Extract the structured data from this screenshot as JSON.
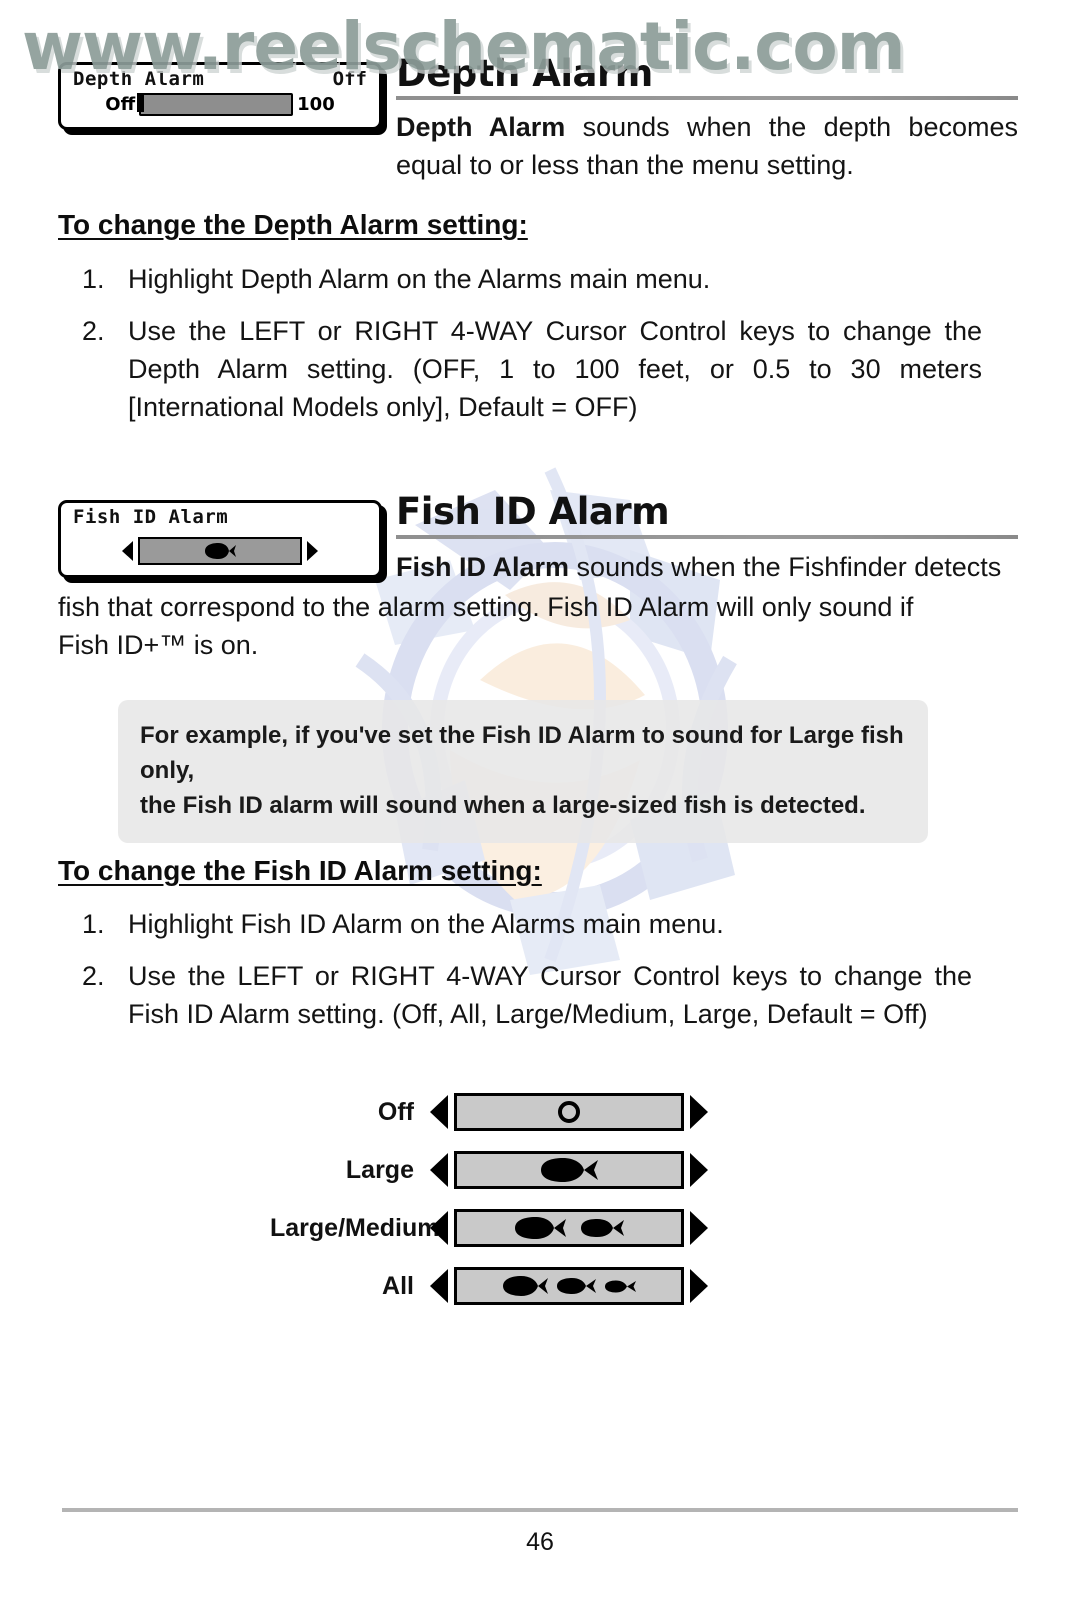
{
  "watermark": {
    "url_text": "www.reelschematic.com",
    "color": "#8d9d99",
    "logo_blue": "#b9c0e0",
    "logo_peach": "#f6dcc0"
  },
  "depth_widget": {
    "title": "Depth Alarm",
    "value": "Off",
    "slider_min_label": "Off",
    "slider_max_label": "100"
  },
  "depth_section": {
    "heading": "Depth Alarm",
    "paragraph_bold": "Depth Alarm",
    "paragraph_rest": " sounds when the depth becomes equal to or less than the menu setting.",
    "subhead": "To change the Depth Alarm setting:",
    "steps": [
      {
        "marker": "1.",
        "text": "Highlight Depth Alarm on the Alarms main menu."
      },
      {
        "marker": "2.",
        "text": "Use the LEFT or RIGHT 4-WAY Cursor Control keys to change the Depth Alarm setting. (OFF, 1 to 100 feet, or 0.5 to 30 meters [International Models only], Default = OFF)"
      }
    ]
  },
  "fish_widget": {
    "title": "Fish ID Alarm",
    "icon": "fish-icon"
  },
  "fish_section": {
    "heading": "Fish ID Alarm",
    "paragraph_bold": "Fish ID Alarm",
    "paragraph_rest": " sounds when the Fishfinder detects fish that correspond to the alarm setting. Fish ID Alarm will only sound if Fish ID+™ is on.",
    "example_line1": "For example, if you've set the Fish ID Alarm to sound for Large fish only,",
    "example_line2": "the Fish ID alarm will sound when a large-sized fish is detected.",
    "subhead": "To change the Fish ID Alarm setting:",
    "steps": [
      {
        "marker": "1.",
        "text": "Highlight Fish ID Alarm on the Alarms main menu."
      },
      {
        "marker": "2.",
        "text": "Use the LEFT or RIGHT 4-WAY Cursor Control keys to change the Fish ID Alarm setting. (Off, All, Large/Medium, Large, Default = Off)"
      }
    ]
  },
  "options": [
    {
      "label": "Off",
      "icons": "circle",
      "fish_count": 0
    },
    {
      "label": "Large",
      "icons": "fish",
      "fish_count": 1
    },
    {
      "label": "Large/Medium",
      "icons": "fish",
      "fish_count": 2
    },
    {
      "label": "All",
      "icons": "fish",
      "fish_count": 3
    }
  ],
  "footer": {
    "page_number": "46"
  }
}
